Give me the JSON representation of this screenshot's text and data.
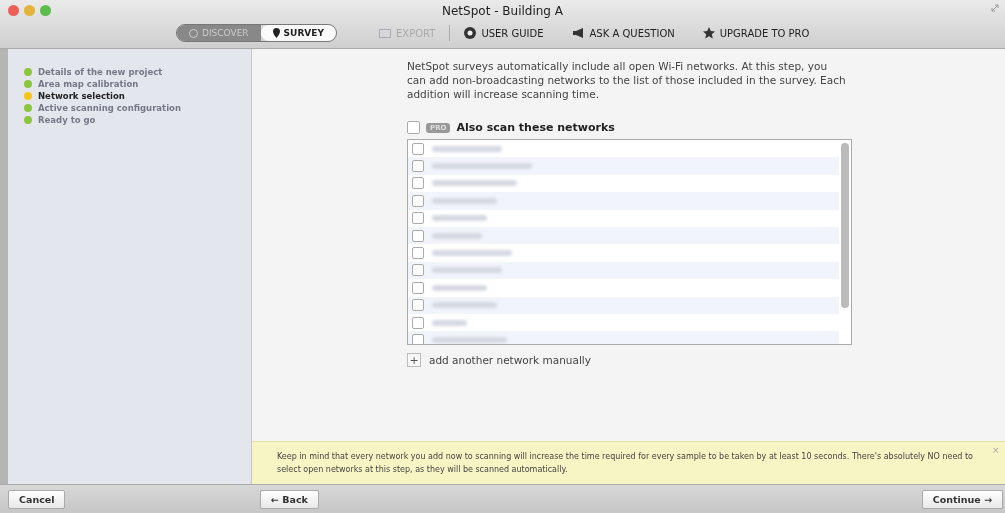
{
  "window": {
    "title": "NetSpot - Building A"
  },
  "toolbar": {
    "modes": [
      {
        "label": "DISCOVER",
        "selected": false
      },
      {
        "label": "SURVEY",
        "selected": true
      }
    ],
    "actions": [
      {
        "label": "EXPORT",
        "disabled": true,
        "kind": "export"
      },
      {
        "label": "USER GUIDE",
        "disabled": false,
        "kind": "guide"
      },
      {
        "label": "ASK A QUESTION",
        "disabled": false,
        "kind": "ask"
      },
      {
        "label": "UPGRADE TO PRO",
        "disabled": false,
        "kind": "star"
      }
    ]
  },
  "steps": [
    {
      "label": "Details of the new project",
      "selected": false,
      "color": "#8cc63f"
    },
    {
      "label": "Area map calibration",
      "selected": false,
      "color": "#8cc63f"
    },
    {
      "label": "Network selection",
      "selected": true,
      "color": "#f5c518"
    },
    {
      "label": "Active scanning configuration",
      "selected": false,
      "color": "#8cc63f"
    },
    {
      "label": "Ready to go",
      "selected": false,
      "color": "#8cc63f"
    }
  ],
  "intro": "NetSpot surveys automatically include all open Wi-Fi networks. At this step, you can add non-broadcasting networks to the list of those included in the survey. Each addition will increase scanning time.",
  "also_scan": {
    "checked": false,
    "badge": "PRO",
    "label": "Also scan these networks"
  },
  "networks": [
    {
      "checked": false
    },
    {
      "checked": false
    },
    {
      "checked": false
    },
    {
      "checked": false
    },
    {
      "checked": false
    },
    {
      "checked": false
    },
    {
      "checked": false
    },
    {
      "checked": false
    },
    {
      "checked": false
    },
    {
      "checked": false
    },
    {
      "checked": false
    },
    {
      "checked": false
    }
  ],
  "add_network": {
    "icon": "+",
    "label": "add another network manually"
  },
  "notice": {
    "text": "Keep in mind that every network you add now to scanning will increase the time required for every sample to be taken by at least 10 seconds. There's absolutely NO need to select open networks at this step, as they will be scanned automatically.",
    "close": "×"
  },
  "buttons": {
    "cancel": "Cancel",
    "back": "← Back",
    "continue": "Continue →"
  }
}
